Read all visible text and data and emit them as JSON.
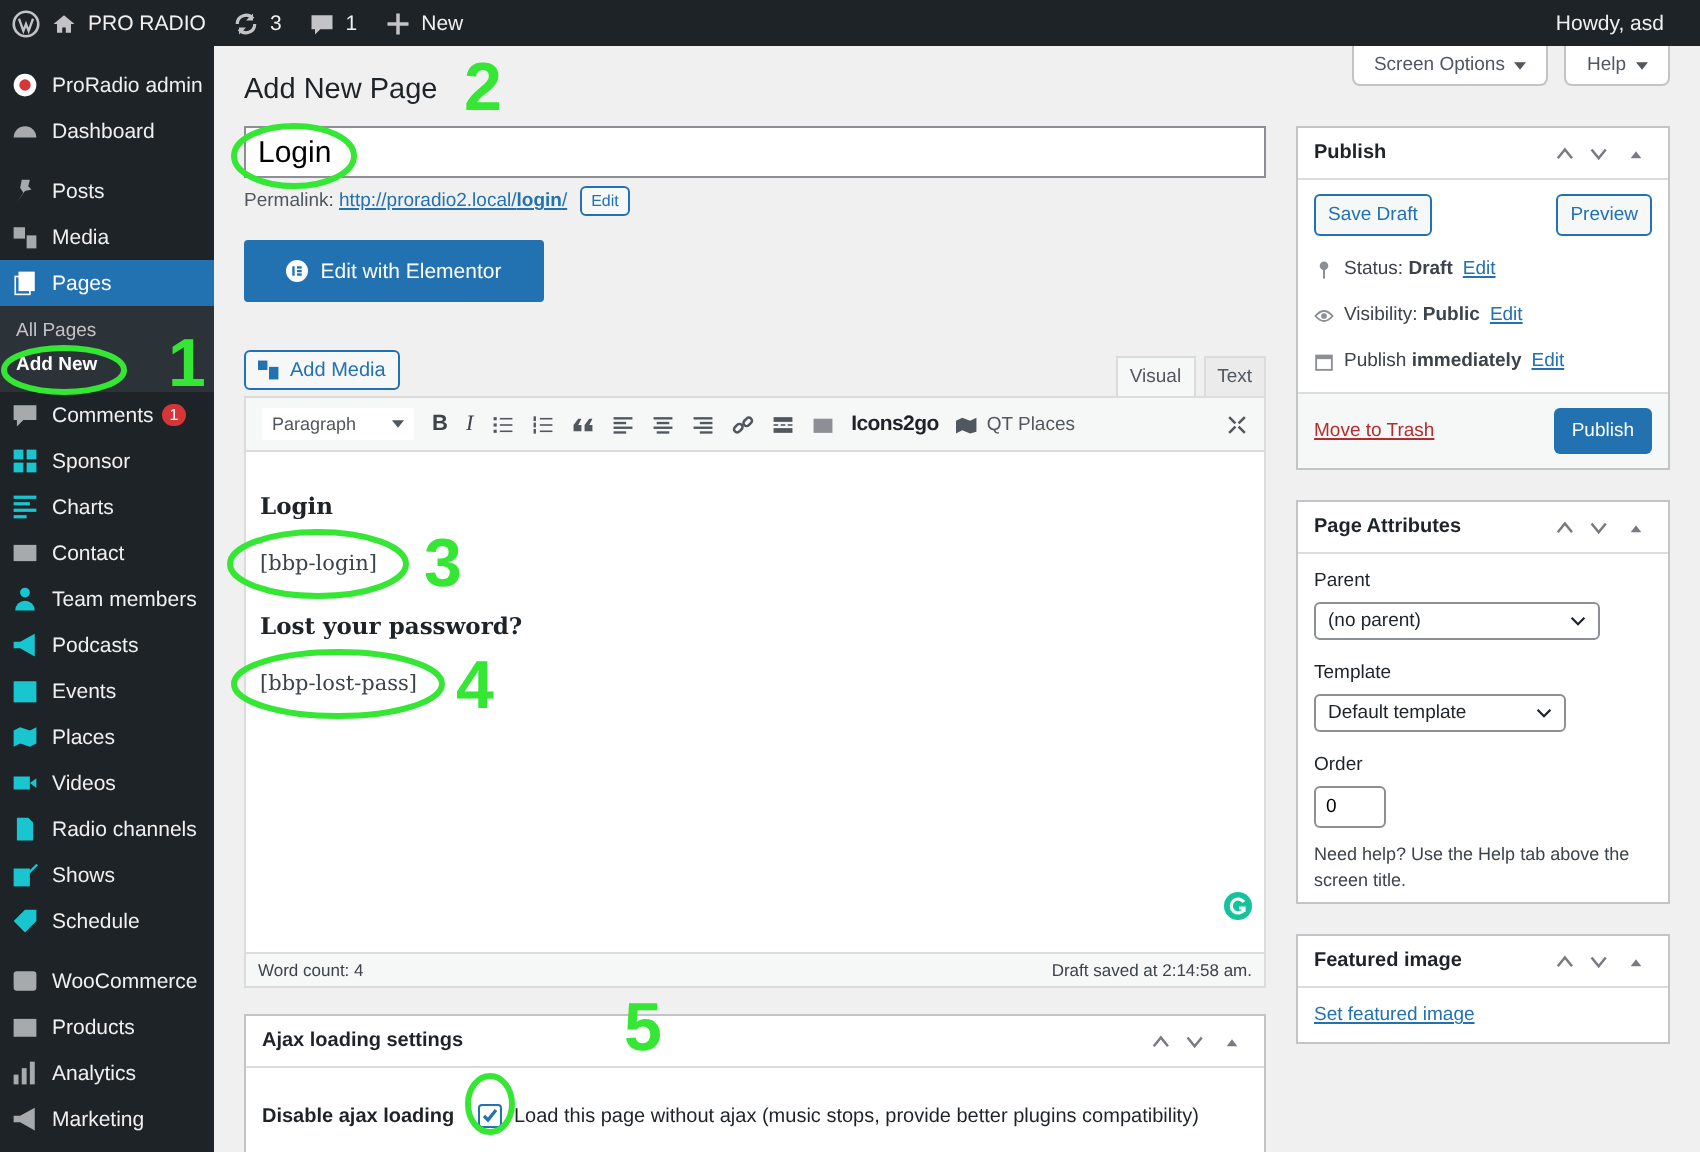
{
  "admin_bar": {
    "site": "PRO RADIO",
    "updates": "3",
    "comments": "1",
    "new": "New",
    "greeting": "Howdy, asd"
  },
  "sidebar": {
    "groups": [
      [
        {
          "label": "ProRadio admin",
          "selected": false
        },
        {
          "label": "Dashboard",
          "selected": false
        }
      ],
      [
        {
          "label": "Posts",
          "selected": false
        },
        {
          "label": "Media",
          "selected": false
        },
        {
          "label": "Pages",
          "selected": true,
          "children": [
            {
              "label": "All Pages",
              "selected": false
            },
            {
              "label": "Add New",
              "selected": true
            }
          ]
        },
        {
          "label": "Comments",
          "selected": false,
          "badge": "1"
        },
        {
          "label": "Sponsor",
          "selected": false
        },
        {
          "label": "Charts",
          "selected": false
        },
        {
          "label": "Contact",
          "selected": false
        },
        {
          "label": "Team members",
          "selected": false
        },
        {
          "label": "Podcasts",
          "selected": false
        },
        {
          "label": "Events",
          "selected": false
        },
        {
          "label": "Places",
          "selected": false
        },
        {
          "label": "Videos",
          "selected": false
        },
        {
          "label": "Radio channels",
          "selected": false
        },
        {
          "label": "Shows",
          "selected": false
        },
        {
          "label": "Schedule",
          "selected": false
        }
      ],
      [
        {
          "label": "WooCommerce",
          "selected": false
        },
        {
          "label": "Products",
          "selected": false
        },
        {
          "label": "Analytics",
          "selected": false
        },
        {
          "label": "Marketing",
          "selected": false
        }
      ]
    ]
  },
  "screen_buttons": [
    "Screen Options",
    "Help"
  ],
  "page_title": "Add New Page",
  "title_field": {
    "value": "Login"
  },
  "permalink": {
    "label": "Permalink:",
    "url_start": "http://proradio2.local/",
    "url_slug": "login",
    "url_end": "/",
    "edit": "Edit"
  },
  "elementor_button": "Edit with Elementor",
  "editor": {
    "add_media": "Add Media",
    "tabs": [
      {
        "label": "Visual",
        "selected": true
      },
      {
        "label": "Text",
        "selected": false
      }
    ],
    "toolbar": {
      "format": "Paragraph",
      "bold": "B",
      "italic": "I",
      "icons2go": "Icons2go",
      "qt_places": "QT Places"
    },
    "content": [
      {
        "kind": "heading",
        "text": "Login"
      },
      {
        "kind": "paragraph",
        "text": "[bbp-login]"
      },
      {
        "kind": "heading",
        "text": "Lost your password?"
      },
      {
        "kind": "paragraph",
        "text": "[bbp-lost-pass]"
      }
    ],
    "word_count": "Word count: 4",
    "saved": "Draft saved at 2:14:58 am."
  },
  "ajax_box": {
    "title": "Ajax loading settings",
    "label": "Disable ajax loading",
    "checkbox": {
      "label": "Load this page without ajax (music stops, provide better plugins compatibility)",
      "checked": true
    }
  },
  "publish_box": {
    "title": "Publish",
    "save_draft": "Save Draft",
    "preview": "Preview",
    "rows": [
      {
        "text": "Status: **Draft**",
        "link": "Edit"
      },
      {
        "text": "Visibility: **Public**",
        "link": "Edit"
      },
      {
        "text": "Publish **immediately**",
        "link": "Edit"
      }
    ],
    "trash": "Move to Trash",
    "publish": "Publish"
  },
  "attributes_box": {
    "title": "Page Attributes",
    "parent_label": "Parent",
    "parent": "(no parent)",
    "template_label": "Template",
    "template": "Default template",
    "order_label": "Order",
    "order": "0",
    "help": "Need help? Use the Help tab above the screen title."
  },
  "featured_box": {
    "title": "Featured image",
    "link": "Set featured image"
  },
  "annotations": [
    {
      "label": "1"
    },
    {
      "label": "2"
    },
    {
      "label": "3"
    },
    {
      "label": "4"
    },
    {
      "label": "5"
    }
  ]
}
